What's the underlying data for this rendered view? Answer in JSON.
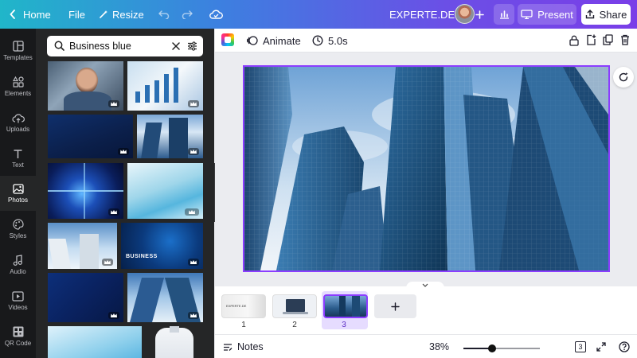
{
  "colors": {
    "accent": "#8b3dff",
    "left_nav": "#18191b",
    "panel": "#252627"
  },
  "topbar": {
    "home_label": "Home",
    "file_label": "File",
    "resize_label": "Resize",
    "brand_label": "EXPERTE.DE",
    "present_label": "Present",
    "share_label": "Share"
  },
  "leftnav": {
    "items": [
      {
        "label": "Templates",
        "icon": "templates-icon"
      },
      {
        "label": "Elements",
        "icon": "elements-icon"
      },
      {
        "label": "Uploads",
        "icon": "cloud-upload-icon"
      },
      {
        "label": "Text",
        "icon": "text-icon"
      },
      {
        "label": "Photos",
        "icon": "photo-icon",
        "active": true
      },
      {
        "label": "Styles",
        "icon": "palette-icon"
      },
      {
        "label": "Audio",
        "icon": "music-note-icon"
      },
      {
        "label": "Videos",
        "icon": "video-icon"
      },
      {
        "label": "QR Code",
        "icon": "qr-code-icon"
      }
    ]
  },
  "search": {
    "value": "Business blue"
  },
  "editor": {
    "animate_label": "Animate",
    "duration_label": "5.0s"
  },
  "pages": {
    "items": [
      {
        "number": "1"
      },
      {
        "number": "2"
      },
      {
        "number": "3",
        "selected": true
      }
    ],
    "thumb1_text": "EXPERTE.DE"
  },
  "footer": {
    "notes_label": "Notes",
    "zoom_label": "38%",
    "zoom_value": 0.38,
    "page_count": "3"
  }
}
